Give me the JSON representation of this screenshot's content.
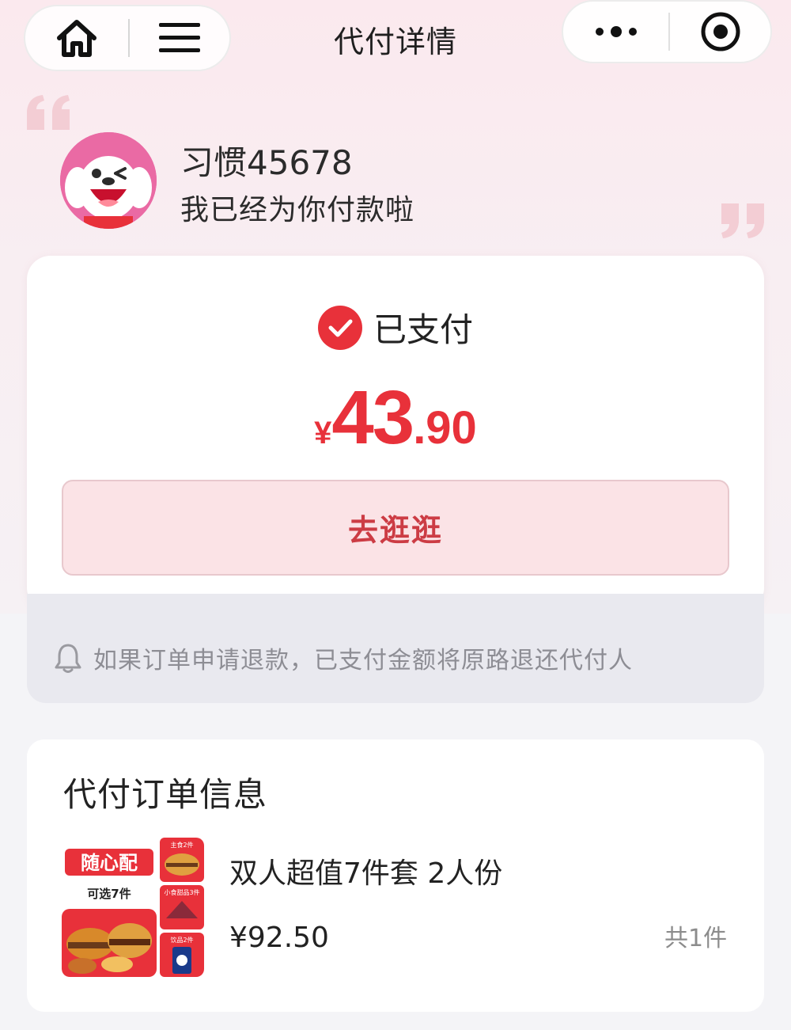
{
  "nav": {
    "title": "代付详情",
    "home_icon": "home-icon",
    "menu_icon": "menu-icon",
    "more_icon": "more-dots-icon",
    "target_icon": "target-icon"
  },
  "payer": {
    "name": "习惯45678",
    "message": "我已经为你付款啦",
    "avatar": "jd-mascot-avatar"
  },
  "payment": {
    "status": "已支付",
    "currency": "¥",
    "amount_int": "43",
    "amount_dec": ".90",
    "shop_button_label": "去逛逛",
    "accent_color": "#e8313a"
  },
  "notice": {
    "text": "如果订单申请退款，已支付金额将原路退还代付人"
  },
  "order": {
    "title": "代付订单信息",
    "product_name": "双人超值7件套 2人份",
    "price": "¥92.50",
    "quantity": "共1件",
    "image_texts": {
      "brand": "随心配",
      "pick": "可选7件",
      "tag1": "主食2件",
      "tag2": "小食甜品3件",
      "tag3": "饮品2件"
    }
  }
}
